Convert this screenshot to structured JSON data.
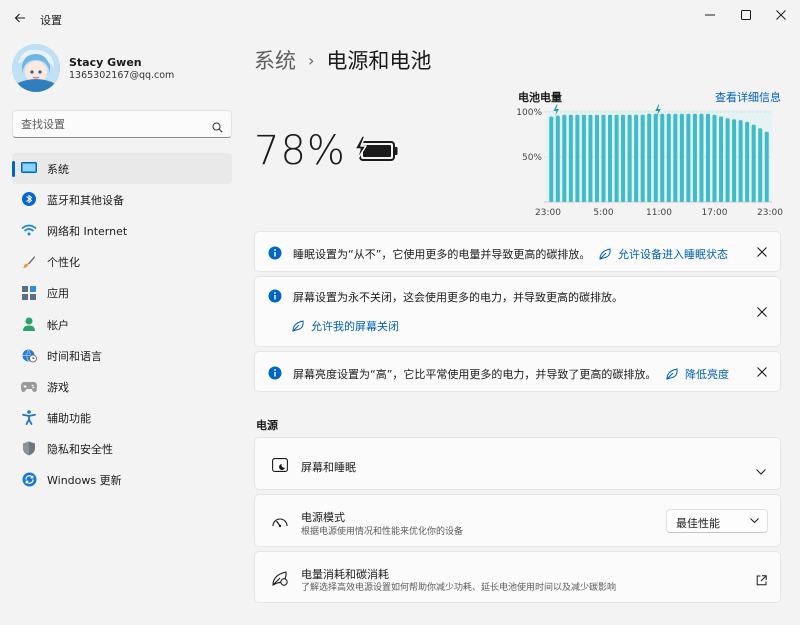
{
  "window": {
    "title": "设置",
    "controls": [
      "minimize",
      "maximize",
      "close"
    ]
  },
  "profile": {
    "name": "Stacy Gwen",
    "email": "1365302167@qq.com"
  },
  "search": {
    "placeholder": "查找设置"
  },
  "sidebar": {
    "items": [
      {
        "label": "系统",
        "icon": "system-icon",
        "active": true
      },
      {
        "label": "蓝牙和其他设备",
        "icon": "bluetooth-icon"
      },
      {
        "label": "网络和 Internet",
        "icon": "wifi-icon"
      },
      {
        "label": "个性化",
        "icon": "brush-icon"
      },
      {
        "label": "应用",
        "icon": "apps-icon"
      },
      {
        "label": "帐户",
        "icon": "person-icon"
      },
      {
        "label": "时间和语言",
        "icon": "globe-clock-icon"
      },
      {
        "label": "游戏",
        "icon": "gamepad-icon"
      },
      {
        "label": "辅助功能",
        "icon": "accessibility-icon"
      },
      {
        "label": "隐私和安全性",
        "icon": "shield-icon"
      },
      {
        "label": "Windows 更新",
        "icon": "update-icon"
      }
    ]
  },
  "breadcrumb": {
    "parent": "系统",
    "current": "电源和电池"
  },
  "battery": {
    "percent_text": "78%",
    "charging": true,
    "icon": "battery-charging-icon"
  },
  "chart_data": {
    "type": "bar",
    "title": "电池电量",
    "link": "查看详细信息",
    "x_ticks": [
      "23:00",
      "5:00",
      "11:00",
      "17:00",
      "23:00"
    ],
    "y_ticks": [
      "100%",
      "50%"
    ],
    "ylim": [
      0,
      100
    ],
    "values": [
      95,
      96,
      97,
      97,
      97,
      97,
      97,
      97,
      97,
      97,
      97,
      97,
      97,
      97,
      97,
      98,
      98,
      98,
      98,
      98,
      98,
      98,
      98,
      98,
      98,
      97,
      95,
      93,
      92,
      91,
      89,
      86,
      82,
      78
    ],
    "charging_markers": [
      "23:00",
      "10:00"
    ],
    "bar_color": "#40bcc8"
  },
  "notices": [
    {
      "text": "睡眠设置为“从不”，它使用更多的电量并导致更高的碳排放。",
      "action": "允许设备进入睡眠状态"
    },
    {
      "text": "屏幕设置为永不关闭，这会使用更多的电力，并导致更高的碳排放。",
      "action": "允许我的屏幕关闭"
    },
    {
      "text": "屏幕亮度设置为“高”，它比平常使用更多的电力，并导致了更高的碳排放。",
      "action": "降低亮度"
    }
  ],
  "power_section": {
    "title": "电源",
    "screen_sleep": {
      "title": "屏幕和睡眠"
    },
    "power_mode": {
      "title": "电源模式",
      "subtitle": "根据电源使用情况和性能来优化你的设备",
      "value": "最佳性能"
    },
    "consumption": {
      "title": "电量消耗和碳消耗",
      "subtitle": "了解选择高效电源设置如何帮助你减少功耗、延长电池使用时间以及减少碳影响"
    }
  },
  "colors": {
    "accent": "#0067c0",
    "link": "#005fb8",
    "chart_bar": "#40bcc8",
    "chart_bg": "#e6f3f4"
  }
}
